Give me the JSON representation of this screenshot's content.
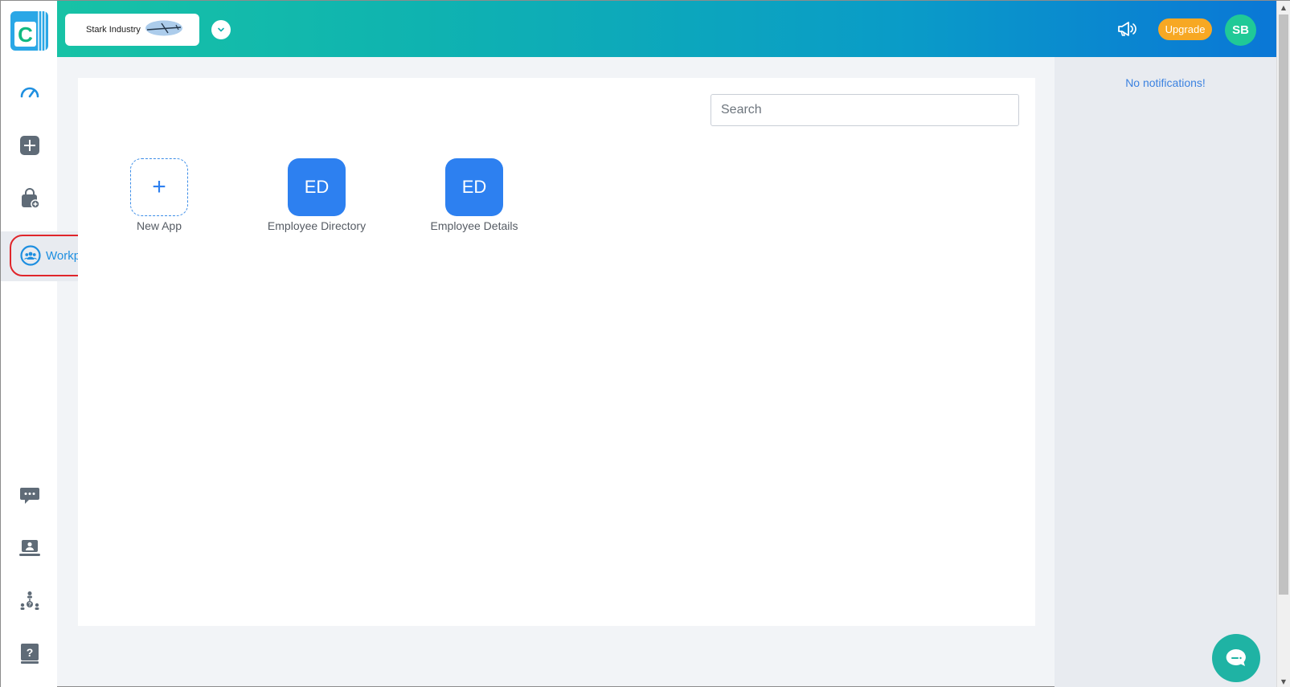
{
  "header": {
    "org_name": "Stark Industry",
    "upgrade_label": "Upgrade",
    "avatar_initials": "SB",
    "icons": [
      "chevron-down-icon",
      "megaphone-icon"
    ]
  },
  "rail": {
    "icons": [
      "dashboard-icon",
      "add-square-icon",
      "store-bag-icon",
      "workplace-icon",
      "chat-icon",
      "monitor-user-icon",
      "org-chart-icon",
      "help-book-icon"
    ],
    "flyout_label": "Workplace Details"
  },
  "search": {
    "placeholder": "Search"
  },
  "apps": [
    {
      "initials": "+",
      "label": "New App"
    },
    {
      "initials": "ED",
      "label": "Employee Directory"
    },
    {
      "initials": "ED",
      "label": "Employee Details"
    }
  ],
  "notifications": {
    "empty_text": "No notifications!"
  },
  "colors": {
    "accent": "#2d80f0",
    "upgrade": "#f7a823",
    "avatar": "#20c997",
    "highlight_ring": "#e0262b",
    "chat_fab": "#1fb3a4"
  }
}
